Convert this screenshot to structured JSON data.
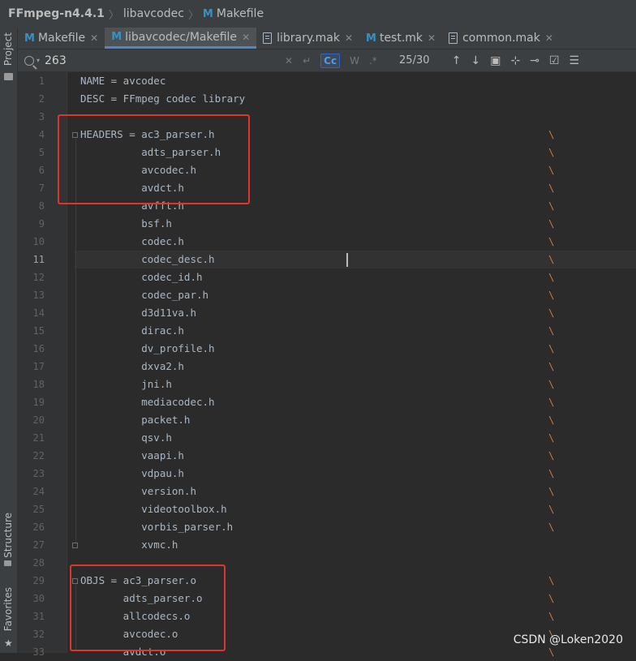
{
  "breadcrumb": {
    "project": "FFmpeg-n4.4.1",
    "folder": "libavcodec",
    "file_icon": "M",
    "file": "Makefile"
  },
  "tabs": [
    {
      "icon": "M",
      "label": "Makefile",
      "active": false
    },
    {
      "icon": "M",
      "label": "libavcodec/Makefile",
      "active": true
    },
    {
      "icon": "doc",
      "label": "library.mak",
      "active": false
    },
    {
      "icon": "M",
      "label": "test.mk",
      "active": false
    },
    {
      "icon": "doc",
      "label": "common.mak",
      "active": false
    }
  ],
  "tab_close": "✕",
  "search": {
    "query": "263",
    "case_label": "Cc",
    "words_label": "W",
    "regex_label": ".*",
    "count": "25/30"
  },
  "side_labels": {
    "project": "Project",
    "structure": "Structure",
    "favorites": "Favorites"
  },
  "current_line": 11,
  "code_lines": [
    {
      "n": 1,
      "text": "NAME = avcodec",
      "bs": false
    },
    {
      "n": 2,
      "text": "DESC = FFmpeg codec library",
      "bs": false
    },
    {
      "n": 3,
      "text": "",
      "bs": false
    },
    {
      "n": 4,
      "text": "HEADERS = ac3_parser.h",
      "bs": true
    },
    {
      "n": 5,
      "text": "          adts_parser.h",
      "bs": true
    },
    {
      "n": 6,
      "text": "          avcodec.h",
      "bs": true
    },
    {
      "n": 7,
      "text": "          avdct.h",
      "bs": true
    },
    {
      "n": 8,
      "text": "          avfft.h",
      "bs": true
    },
    {
      "n": 9,
      "text": "          bsf.h",
      "bs": true
    },
    {
      "n": 10,
      "text": "          codec.h",
      "bs": true
    },
    {
      "n": 11,
      "text": "          codec_desc.h",
      "bs": true
    },
    {
      "n": 12,
      "text": "          codec_id.h",
      "bs": true
    },
    {
      "n": 13,
      "text": "          codec_par.h",
      "bs": true
    },
    {
      "n": 14,
      "text": "          d3d11va.h",
      "bs": true
    },
    {
      "n": 15,
      "text": "          dirac.h",
      "bs": true
    },
    {
      "n": 16,
      "text": "          dv_profile.h",
      "bs": true
    },
    {
      "n": 17,
      "text": "          dxva2.h",
      "bs": true
    },
    {
      "n": 18,
      "text": "          jni.h",
      "bs": true
    },
    {
      "n": 19,
      "text": "          mediacodec.h",
      "bs": true
    },
    {
      "n": 20,
      "text": "          packet.h",
      "bs": true
    },
    {
      "n": 21,
      "text": "          qsv.h",
      "bs": true
    },
    {
      "n": 22,
      "text": "          vaapi.h",
      "bs": true
    },
    {
      "n": 23,
      "text": "          vdpau.h",
      "bs": true
    },
    {
      "n": 24,
      "text": "          version.h",
      "bs": true
    },
    {
      "n": 25,
      "text": "          videotoolbox.h",
      "bs": true
    },
    {
      "n": 26,
      "text": "          vorbis_parser.h",
      "bs": true
    },
    {
      "n": 27,
      "text": "          xvmc.h",
      "bs": false
    },
    {
      "n": 28,
      "text": "",
      "bs": false
    },
    {
      "n": 29,
      "text": "OBJS = ac3_parser.o",
      "bs": true
    },
    {
      "n": 30,
      "text": "       adts_parser.o",
      "bs": true
    },
    {
      "n": 31,
      "text": "       allcodecs.o",
      "bs": true
    },
    {
      "n": 32,
      "text": "       avcodec.o",
      "bs": true
    },
    {
      "n": 33,
      "text": "       avdct.o",
      "bs": true
    }
  ],
  "backslash": "\\",
  "watermark": "CSDN @Loken2020",
  "colors": {
    "highlight": "#e0352b",
    "accent": "#4a88c7",
    "keyword": "#cc7832"
  }
}
